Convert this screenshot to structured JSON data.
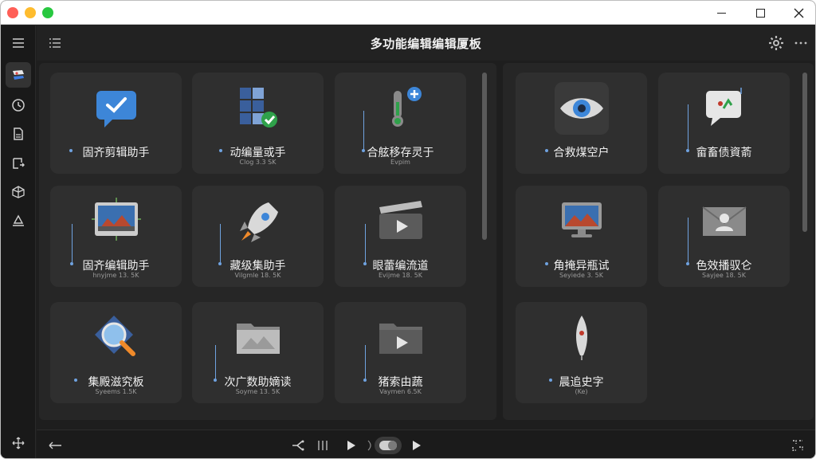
{
  "app": {
    "title": "多功能编辑编辑厦板"
  },
  "rail": {
    "items": [
      {
        "icon": "menu-icon"
      },
      {
        "icon": "layers-icon",
        "active": true
      },
      {
        "icon": "clock-icon"
      },
      {
        "icon": "document-icon"
      },
      {
        "icon": "export-icon"
      },
      {
        "icon": "cube-icon"
      },
      {
        "icon": "upload-icon"
      },
      {
        "icon": "move-icon"
      }
    ]
  },
  "left_panel": {
    "cards": [
      {
        "label": "固齐剪辑助手",
        "sub": "",
        "icon": "chat-check-icon"
      },
      {
        "label": "动编量或手",
        "sub": "Clog 3.3 SK",
        "icon": "grid-check-icon"
      },
      {
        "label": "合舷移存灵于",
        "sub": "Evpim",
        "icon": "thermometer-plus-icon"
      },
      {
        "label": "固齐编辑助手",
        "sub": "hnyjme 13. 5K",
        "icon": "video-preview-icon"
      },
      {
        "label": "藏级集助手",
        "sub": "Vilgmle 18. 5K",
        "icon": "rocket-icon"
      },
      {
        "label": "眼蕾编流道",
        "sub": "Evijme 18. 5K",
        "icon": "clapper-play-icon"
      },
      {
        "label": "集殿滋究板",
        "sub": "Syeems 1.5K",
        "icon": "magnifier-icon"
      },
      {
        "label": "次广数助嫡读",
        "sub": "Soyme 13. 5K",
        "icon": "folder-icon"
      },
      {
        "label": "猪索由蔬",
        "sub": "Vaymen 6.5K",
        "icon": "folder-play-icon"
      }
    ]
  },
  "right_panel": {
    "cards": [
      {
        "label": "合救煤空户",
        "sub": "",
        "icon": "eye-icon"
      },
      {
        "label": "畲畜债資萮",
        "sub": "",
        "icon": "message-icon"
      },
      {
        "label": "角掩异瓶试",
        "sub": "Seyiede 3. 5K",
        "icon": "monitor-icon"
      },
      {
        "label": "色效播驭仑",
        "sub": "Sayjee 18. 5K",
        "icon": "contact-mail-icon"
      },
      {
        "label": "晨追史字",
        "sub": "(Ke)",
        "icon": "feather-icon"
      }
    ]
  },
  "bottom": {
    "buttons": [
      {
        "icon": "back-arrow-icon"
      },
      {
        "icon": "branch-icon"
      },
      {
        "icon": "bars-icon"
      },
      {
        "icon": "play-icon"
      },
      {
        "icon": "toggle-pill-icon"
      },
      {
        "icon": "play-next-icon"
      },
      {
        "icon": "grid-dots-icon"
      }
    ]
  },
  "colors": {
    "background": "#1e1e1e",
    "card": "#2f2f2f",
    "accent": "#6fa2e0",
    "title_text": "#f1f1f1"
  }
}
